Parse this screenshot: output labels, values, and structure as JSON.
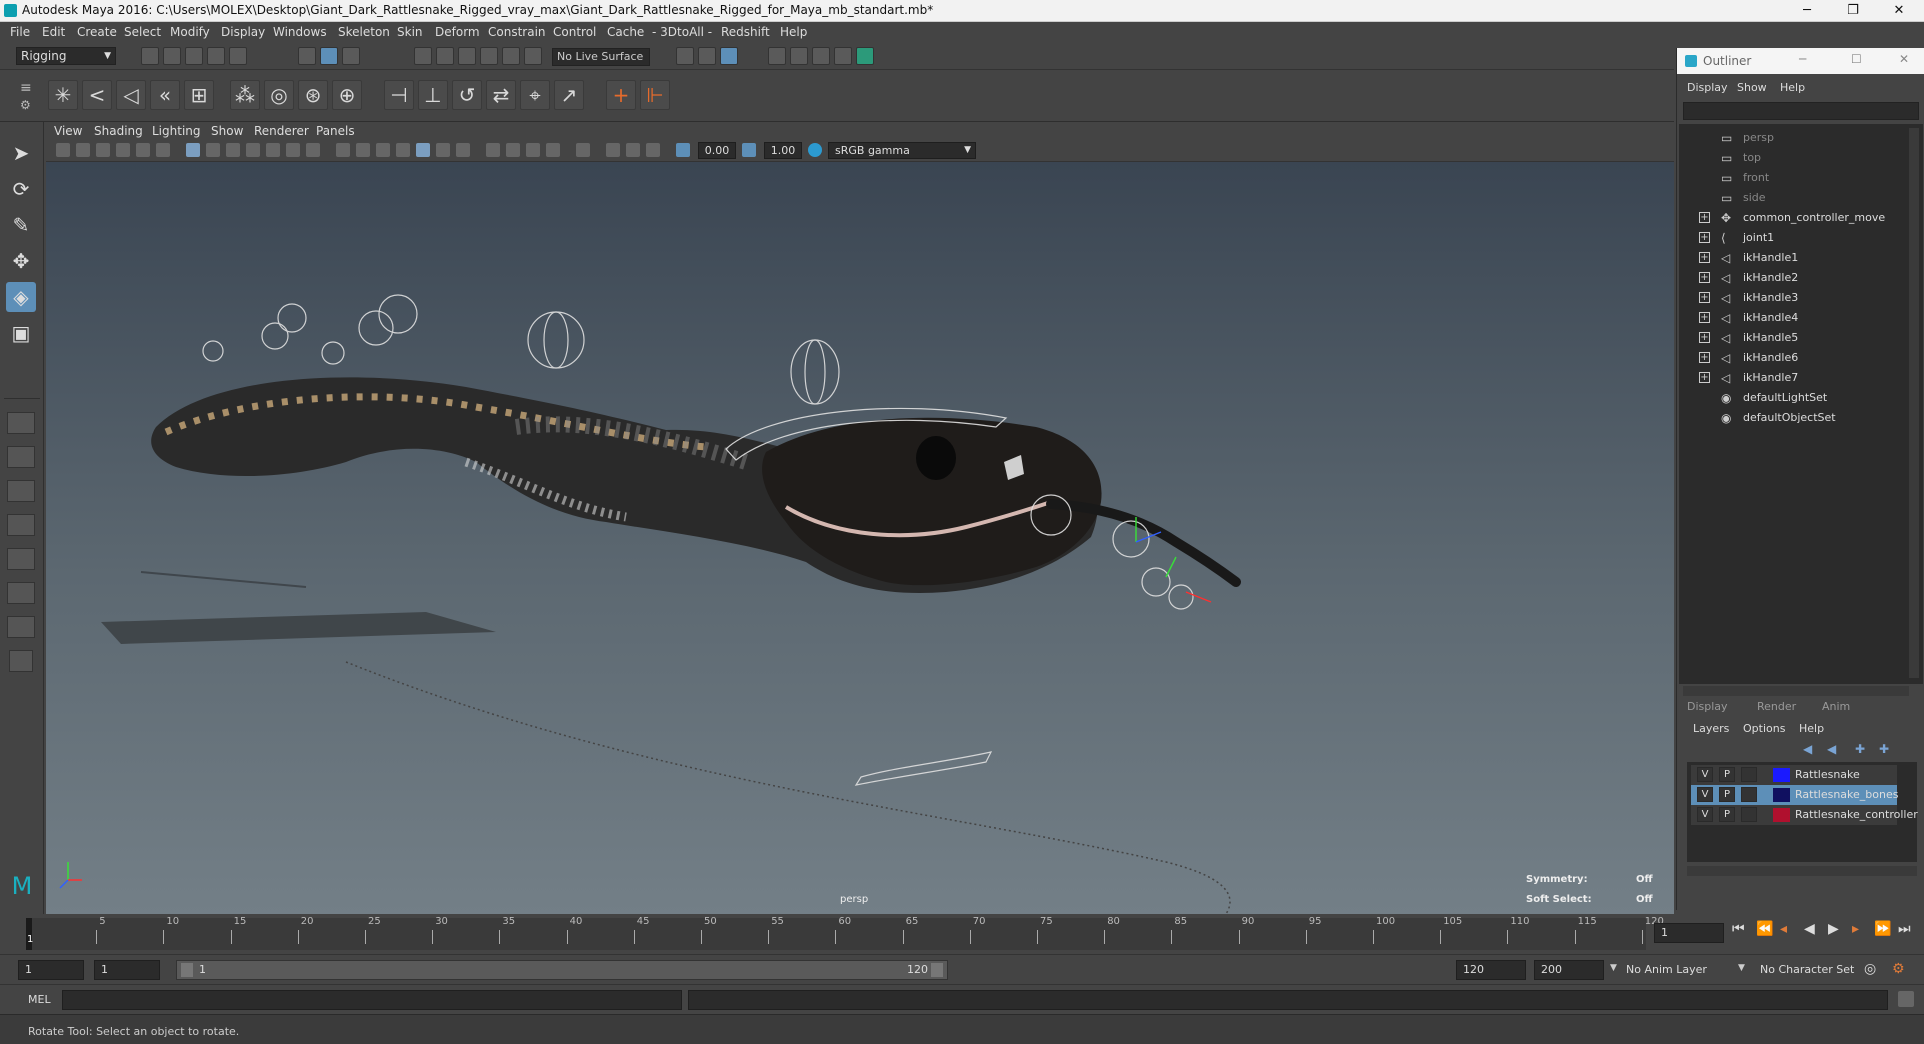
{
  "window": {
    "title": "Autodesk Maya 2016: C:\\Users\\MOLEX\\Desktop\\Giant_Dark_Rattlesnake_Rigged_vray_max\\Giant_Dark_Rattlesnake_Rigged_for_Maya_mb_standart.mb*"
  },
  "menubar": [
    "File",
    "Edit",
    "Create",
    "Select",
    "Modify",
    "Display",
    "Windows",
    "Skeleton",
    "Skin",
    "Deform",
    "Constrain",
    "Control",
    "Cache",
    "- 3DtoAll -",
    "Redshift",
    "Help"
  ],
  "status_line": {
    "mode": "Rigging",
    "live_surface": "No Live Surface"
  },
  "viewport": {
    "menu": [
      "View",
      "Shading",
      "Lighting",
      "Show",
      "Renderer",
      "Panels"
    ],
    "near_value": "0.00",
    "far_value": "1.00",
    "color_space": "sRGB gamma",
    "camera_label": "persp",
    "hud": [
      {
        "label": "Symmetry:",
        "value": "Off"
      },
      {
        "label": "Soft Select:",
        "value": "Off"
      }
    ]
  },
  "outliner": {
    "title": "Outliner",
    "menu": [
      "Display",
      "Show",
      "Help"
    ],
    "items": [
      {
        "name": "persp",
        "icon": "camera-icon",
        "dim": true,
        "expand": false
      },
      {
        "name": "top",
        "icon": "camera-icon",
        "dim": true,
        "expand": false
      },
      {
        "name": "front",
        "icon": "camera-icon",
        "dim": true,
        "expand": false
      },
      {
        "name": "side",
        "icon": "camera-icon",
        "dim": true,
        "expand": false
      },
      {
        "name": "common_controller_move",
        "icon": "controller-icon",
        "dim": false,
        "expand": true
      },
      {
        "name": "joint1",
        "icon": "joint-icon",
        "dim": false,
        "expand": true
      },
      {
        "name": "ikHandle1",
        "icon": "ik-handle-icon",
        "dim": false,
        "expand": true
      },
      {
        "name": "ikHandle2",
        "icon": "ik-handle-icon",
        "dim": false,
        "expand": true
      },
      {
        "name": "ikHandle3",
        "icon": "ik-handle-icon",
        "dim": false,
        "expand": true
      },
      {
        "name": "ikHandle4",
        "icon": "ik-handle-icon",
        "dim": false,
        "expand": true
      },
      {
        "name": "ikHandle5",
        "icon": "ik-handle-icon",
        "dim": false,
        "expand": true
      },
      {
        "name": "ikHandle6",
        "icon": "ik-handle-icon",
        "dim": false,
        "expand": true
      },
      {
        "name": "ikHandle7",
        "icon": "ik-handle-icon",
        "dim": false,
        "expand": true
      },
      {
        "name": "defaultLightSet",
        "icon": "set-icon",
        "dim": false,
        "expand": false
      },
      {
        "name": "defaultObjectSet",
        "icon": "set-icon",
        "dim": false,
        "expand": false
      }
    ]
  },
  "layer_editor": {
    "tabs": [
      "Display",
      "Render",
      "Anim"
    ],
    "menu": [
      "Layers",
      "Options",
      "Help"
    ],
    "layers": [
      {
        "v": "V",
        "p": "P",
        "color": "#1a1aff",
        "name": "Rattlesnake",
        "selected": false
      },
      {
        "v": "V",
        "p": "P",
        "color": "#101060",
        "name": "Rattlesnake_bones",
        "selected": true
      },
      {
        "v": "V",
        "p": "P",
        "color": "#b0102e",
        "name": "Rattlesnake_controller",
        "selected": false
      }
    ]
  },
  "timeline": {
    "ticks": [
      "5",
      "10",
      "15",
      "20",
      "25",
      "30",
      "35",
      "40",
      "45",
      "50",
      "55",
      "60",
      "65",
      "70",
      "75",
      "80",
      "85",
      "90",
      "95",
      "100",
      "105",
      "110",
      "115",
      "120"
    ],
    "current_frame_marker": "1",
    "current_frame": "1"
  },
  "range": {
    "start": "1",
    "playback_start": "1",
    "slider_start": "1",
    "slider_end": "120",
    "playback_end": "120",
    "end": "200",
    "anim_layer": "No Anim Layer",
    "character_set": "No Character Set"
  },
  "command_line": {
    "label": "MEL"
  },
  "help_line": {
    "text": "Rotate Tool: Select an object to rotate."
  },
  "colors": {
    "accent": "#5d8fb8"
  }
}
